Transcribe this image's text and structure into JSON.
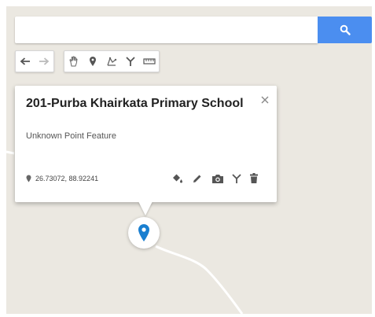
{
  "search": {
    "value": "",
    "placeholder": "",
    "button_icon": "search-icon"
  },
  "toolbar": {
    "history_group": [
      "undo-icon",
      "redo-icon"
    ],
    "tools_group": [
      "hand-icon",
      "add-marker-icon",
      "draw-line-icon",
      "route-icon",
      "measure-icon"
    ]
  },
  "card": {
    "title": "201-Purba Khairkata Primary School",
    "subtitle": "Unknown Point Feature",
    "coordinates": "26.73072, 88.92241",
    "close_icon": "close-icon",
    "actions": [
      "style-icon",
      "edit-icon",
      "camera-icon",
      "directions-icon",
      "delete-icon"
    ]
  },
  "colors": {
    "accent": "#4b8ef0",
    "marker": "#1a7fd0",
    "map_background": "#ebe8e1",
    "road": "#ffffff"
  }
}
